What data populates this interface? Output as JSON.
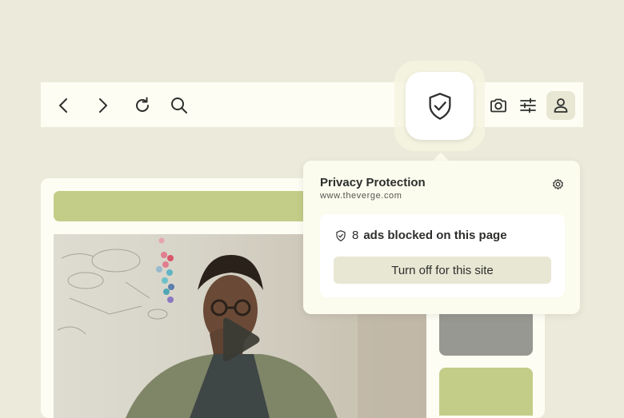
{
  "toolbar": {
    "icons": [
      "back-arrow-icon",
      "forward-arrow-icon",
      "reload-icon",
      "search-icon",
      "shield-check-icon",
      "camera-icon",
      "sliders-icon",
      "user-icon"
    ]
  },
  "popup": {
    "title": "Privacy Protection",
    "site": "www.theverge.com",
    "ads_blocked_count": "8",
    "ads_blocked_text": "ads blocked on this page",
    "turn_off_label": "Turn off for this site"
  },
  "colors": {
    "background": "#ecebdb",
    "accent_green": "#c3cd88",
    "button_bg": "#e8e7d4",
    "dark_icon": "#2d2f2c"
  }
}
